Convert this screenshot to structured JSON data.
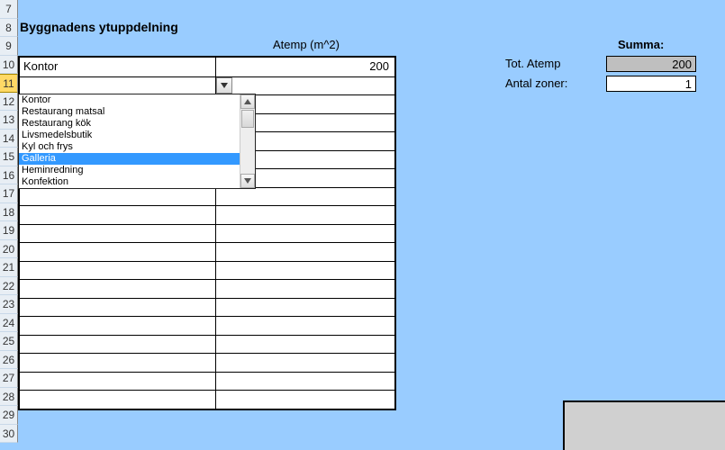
{
  "rows": [
    "7",
    "8",
    "9",
    "10",
    "11",
    "12",
    "13",
    "14",
    "15",
    "16",
    "17",
    "18",
    "19",
    "20",
    "21",
    "22",
    "23",
    "24",
    "25",
    "26",
    "27",
    "28",
    "29",
    "30"
  ],
  "selected_row": "11",
  "section_title": "Byggnadens ytuppdelning",
  "atemp_header": "Atemp (m^2)",
  "summa_label": "Summa:",
  "table": {
    "rows": [
      {
        "a": "Kontor",
        "b": "200"
      },
      {
        "a": "",
        "b": ""
      },
      {
        "a": "",
        "b": ""
      },
      {
        "a": "",
        "b": ""
      },
      {
        "a": "",
        "b": ""
      },
      {
        "a": "",
        "b": ""
      },
      {
        "a": "",
        "b": ""
      },
      {
        "a": "",
        "b": ""
      },
      {
        "a": "",
        "b": ""
      },
      {
        "a": "",
        "b": ""
      },
      {
        "a": "",
        "b": ""
      },
      {
        "a": "",
        "b": ""
      },
      {
        "a": "",
        "b": ""
      },
      {
        "a": "",
        "b": ""
      },
      {
        "a": "",
        "b": ""
      },
      {
        "a": "",
        "b": ""
      },
      {
        "a": "",
        "b": ""
      },
      {
        "a": "",
        "b": ""
      },
      {
        "a": "",
        "b": ""
      }
    ],
    "active_row_index": 1
  },
  "dropdown": {
    "options": [
      "Kontor",
      "Restaurang matsal",
      "Restaurang kök",
      "Livsmedelsbutik",
      "Kyl och frys",
      "Galleria",
      "Heminredning",
      "Konfektion"
    ],
    "selected_index": 5
  },
  "summary": {
    "tot_atemp_label": "Tot. Atemp",
    "tot_atemp_value": "200",
    "antal_zoner_label": "Antal zoner:",
    "antal_zoner_value": "1"
  }
}
